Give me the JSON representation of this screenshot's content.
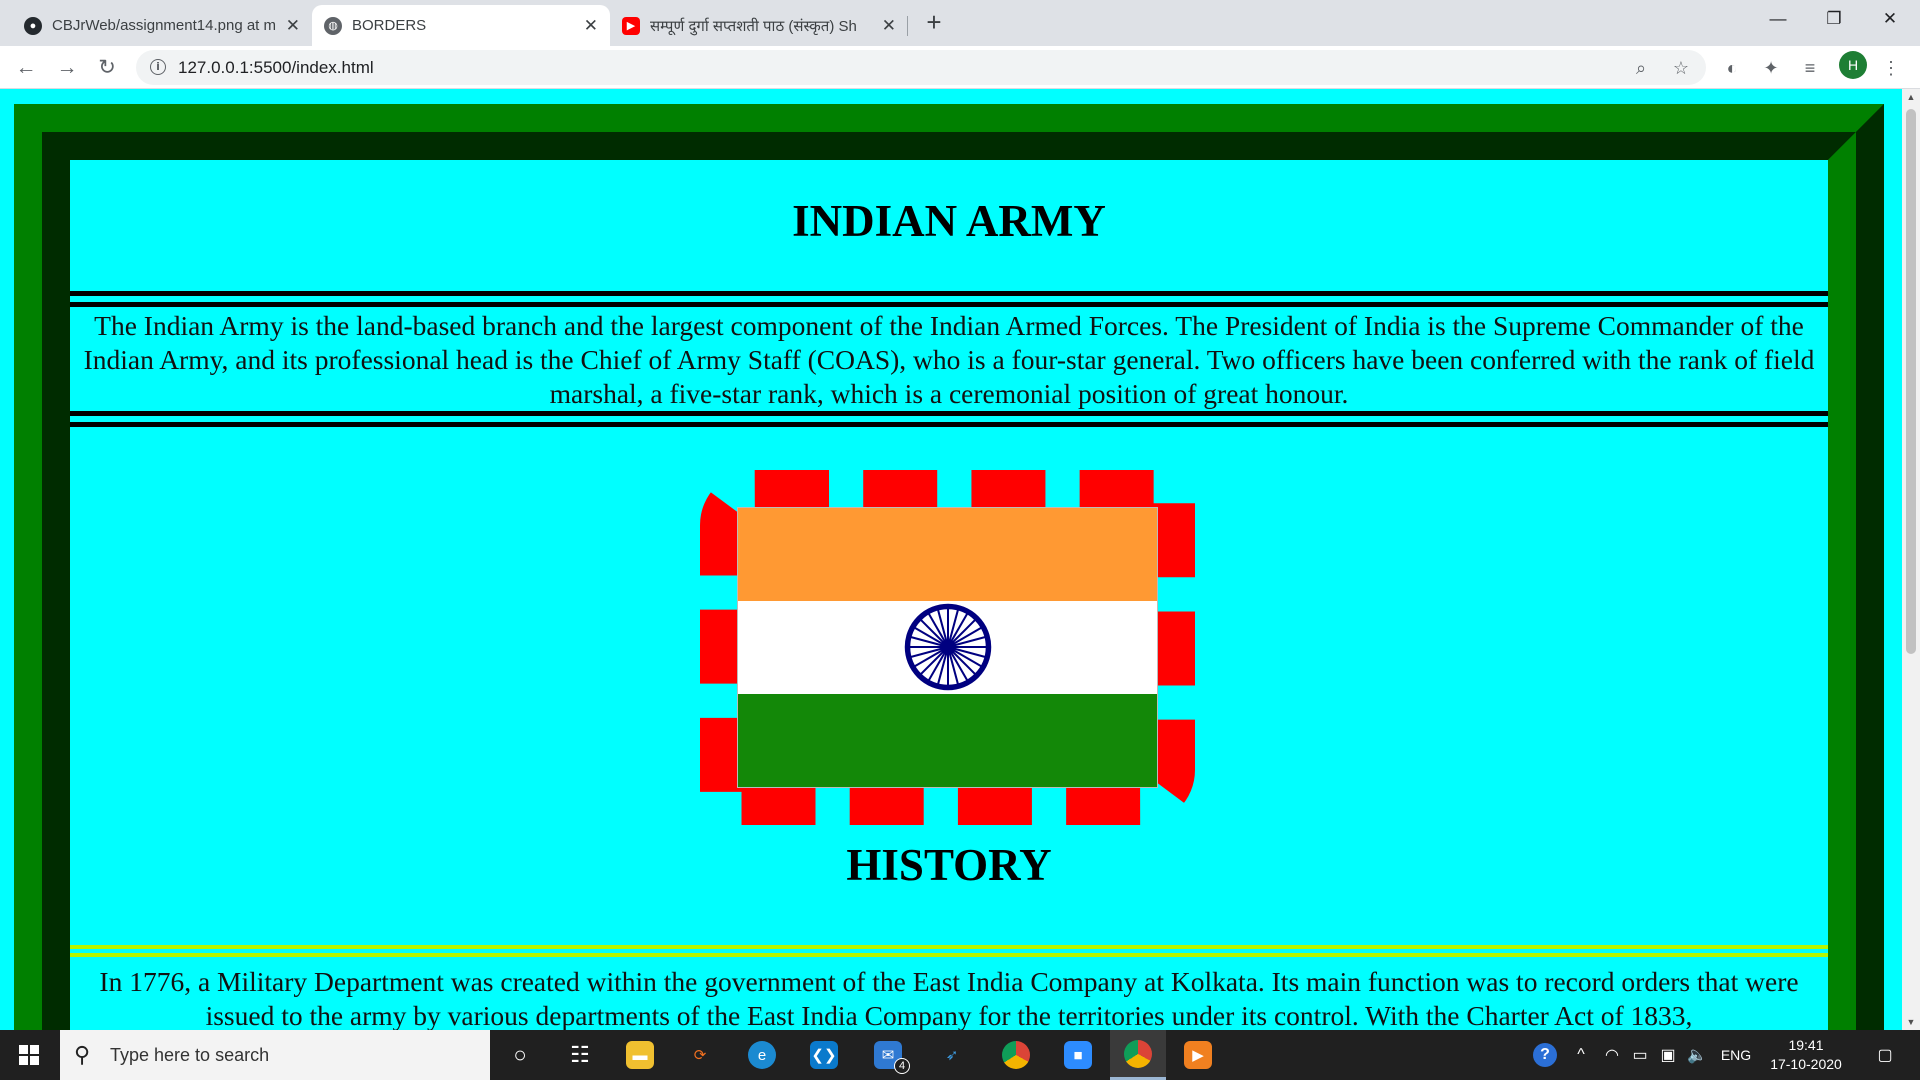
{
  "browser": {
    "tabs": [
      {
        "title": "CBJrWeb/assignment14.png at m",
        "icon": "github-icon"
      },
      {
        "title": "BORDERS",
        "icon": "globe-icon"
      },
      {
        "title": "सम्पूर्ण दुर्गा सप्तशती पाठ (संस्कृत) Sh",
        "icon": "youtube-icon"
      }
    ],
    "new_tab": "+",
    "url": "127.0.0.1:5500/index.html",
    "profile_initial": "H",
    "window_controls": {
      "minimize": "—",
      "restore": "❐",
      "close": "✕"
    }
  },
  "page": {
    "title": "INDIAN ARMY",
    "intro": "The Indian Army is the land-based branch and the largest component of the Indian Armed Forces. The President of India is the Supreme Commander of the Indian Army, and its professional head is the Chief of Army Staff (COAS), who is a four-star general. Two officers have been conferred with the rank of field marshal, a five-star rank, which is a ceremonial position of great honour.",
    "history_title": "HISTORY",
    "history_text": "In 1776, a Military Department was created within the government of the East India Company at Kolkata. Its main function was to record orders that were issued to the army by various departments of the East India Company for the territories under its control. With the Charter Act of 1833,",
    "colors": {
      "background": "#00ffff",
      "frame": "#008000",
      "flag_border": "#ff0000",
      "rule_black": "#000000",
      "rule_green": "#b5f500"
    },
    "flag_colors": {
      "saffron": "#ff9933",
      "white": "#ffffff",
      "green": "#138808",
      "chakra": "#000080"
    }
  },
  "taskbar": {
    "search_placeholder": "Type here to search",
    "apps": [
      "cortana-icon",
      "task-view-icon",
      "file-explorer-icon",
      "sync-icon",
      "edge-icon",
      "vscode-icon",
      "mail-icon",
      "visual-studio-icon",
      "chrome-profile-icon",
      "zoom-icon",
      "chrome-icon",
      "media-player-icon"
    ],
    "mail_badge": "4",
    "language": "ENG",
    "time": "19:41",
    "date": "17-10-2020"
  }
}
